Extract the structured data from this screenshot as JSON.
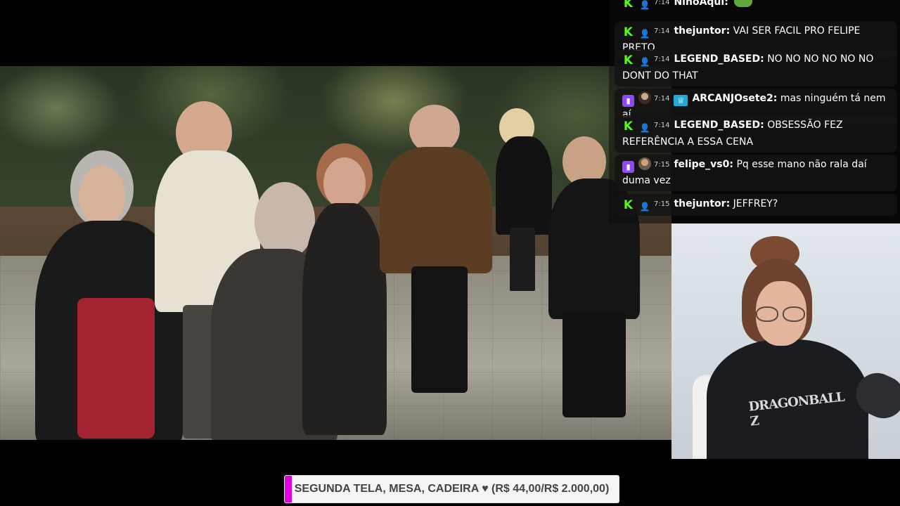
{
  "chat": {
    "messages": [
      {
        "platform": "kick",
        "avatar": "generic-user-icon",
        "time": "7:14",
        "user": "NinoAqui",
        "text": "",
        "emote": "frog-emote"
      },
      {
        "platform": "kick",
        "avatar": "generic-user-icon",
        "time": "7:14",
        "user": "thejuntor",
        "text": "VAI SER FACIL PRO FELIPE PRETO"
      },
      {
        "platform": "kick",
        "avatar": "generic-user-icon",
        "time": "7:14",
        "user": "LEGEND_BASED",
        "text": "NO NO NO NO NO NO DONT DO THAT"
      },
      {
        "platform": "twitch",
        "avatar": "user-photo",
        "badge": "crown-badge",
        "time": "7:14",
        "user": "ARCANJOsete2",
        "text": "mas ninguém tá nem aí"
      },
      {
        "platform": "kick",
        "avatar": "generic-user-icon",
        "time": "7:14",
        "user": "LEGEND_BASED",
        "text": "OBSESSÃO FEZ REFERÊNCIA A ESSA CENA"
      },
      {
        "platform": "twitch",
        "avatar": "user-photo",
        "time": "7:15",
        "user": "felipe_vs0",
        "text": "Pq esse mano não rala daí duma vez"
      },
      {
        "platform": "kick",
        "avatar": "generic-user-icon",
        "time": "7:15",
        "user": "thejuntor",
        "text": "JEFFREY?"
      }
    ]
  },
  "goal": {
    "label": "SEGUNDA TELA, MESA, CADEIRA ♥ (R$ 44,00/R$ 2.000,00)",
    "progress_fraction": 0.022,
    "fill_color": "#e000e0"
  },
  "webcam": {
    "shirt_logo": "DRAGONBALL Z"
  },
  "colors": {
    "kick": "#53fc18",
    "twitch": "#9146ff"
  }
}
